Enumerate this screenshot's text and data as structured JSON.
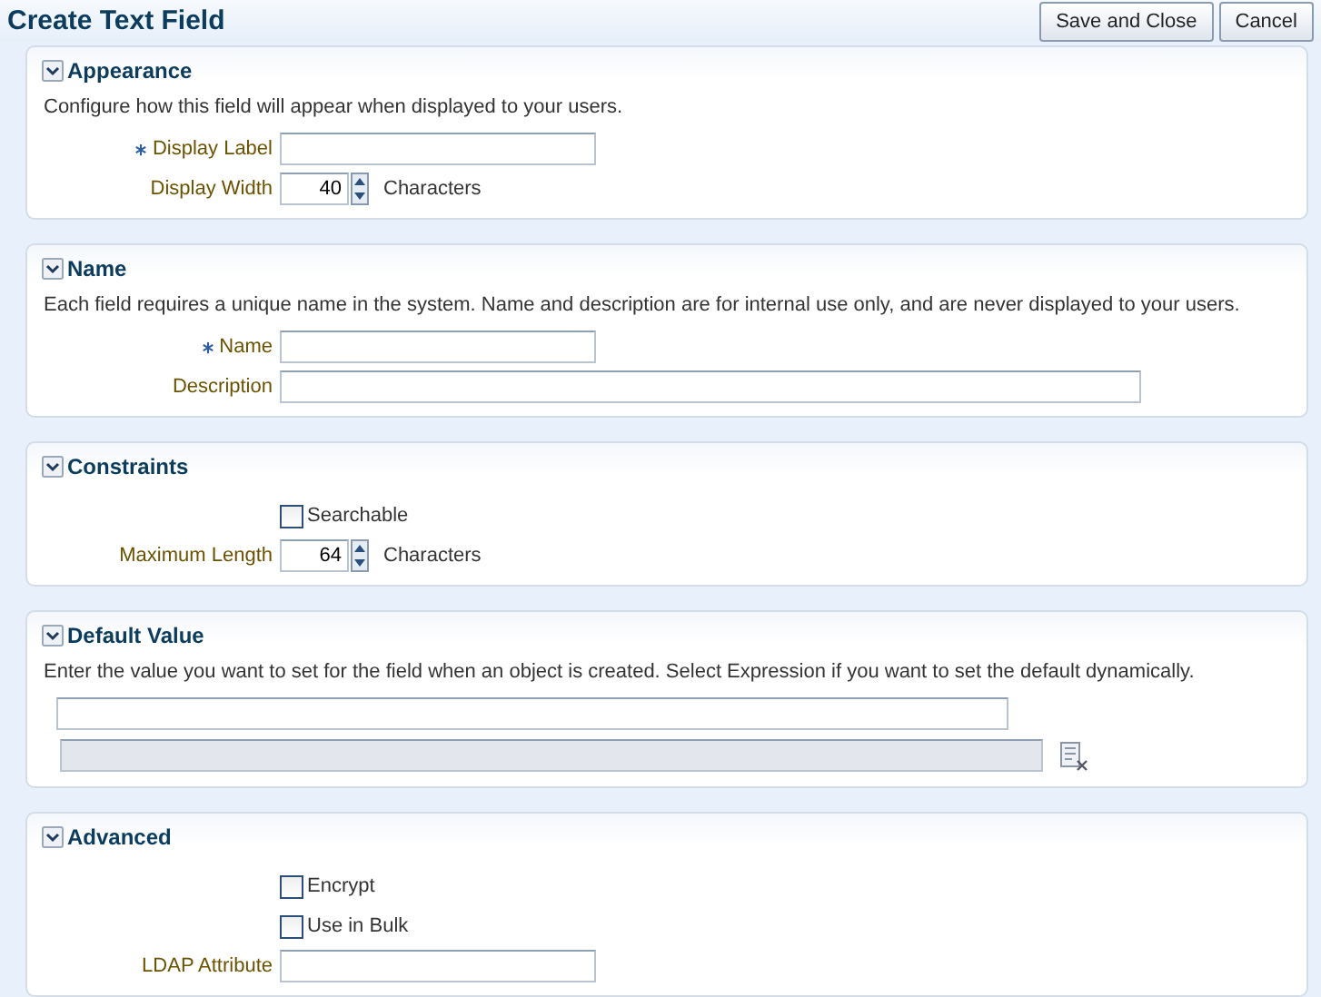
{
  "header": {
    "title": "Create Text Field",
    "buttons": [
      "Save and Close",
      "Cancel"
    ]
  },
  "sections": [
    {
      "title": "Appearance",
      "expanded": true,
      "description": "Configure how this field will appear when displayed to your users.",
      "rows": [
        {
          "kind": "text",
          "label": "Display Label",
          "required": true
        },
        {
          "kind": "spinner",
          "label": "Display Width",
          "required": false,
          "value": "40",
          "suffix": "Characters"
        }
      ]
    },
    {
      "title": "Name",
      "expanded": true,
      "description": "Each field requires a unique name in the system. Name and description are for internal use only, and are never displayed to your users.",
      "rows": [
        {
          "kind": "text",
          "label": "Name",
          "required": true
        },
        {
          "kind": "long_text",
          "label": "Description",
          "required": false
        }
      ]
    },
    {
      "title": "Constraints",
      "expanded": true,
      "rows": [
        {
          "kind": "checkbox",
          "label": "Searchable",
          "checked": false
        },
        {
          "kind": "spinner",
          "label": "Maximum Length",
          "required": false,
          "value": "64",
          "suffix": "Characters"
        }
      ]
    },
    {
      "title": "Default Value",
      "expanded": true,
      "description": "Enter the value you want to set for the field when an object is created. Select Expression if you want to set the default dynamically.",
      "rows": [
        {
          "kind": "plain_text"
        },
        {
          "kind": "expression",
          "disabled": true
        }
      ]
    },
    {
      "title": "Advanced",
      "expanded": true,
      "rows": [
        {
          "kind": "checkbox",
          "label": "Encrypt",
          "checked": false
        },
        {
          "kind": "checkbox",
          "label": "Use in Bulk",
          "checked": false
        },
        {
          "kind": "text",
          "label": "LDAP Attribute",
          "required": false
        }
      ]
    }
  ]
}
